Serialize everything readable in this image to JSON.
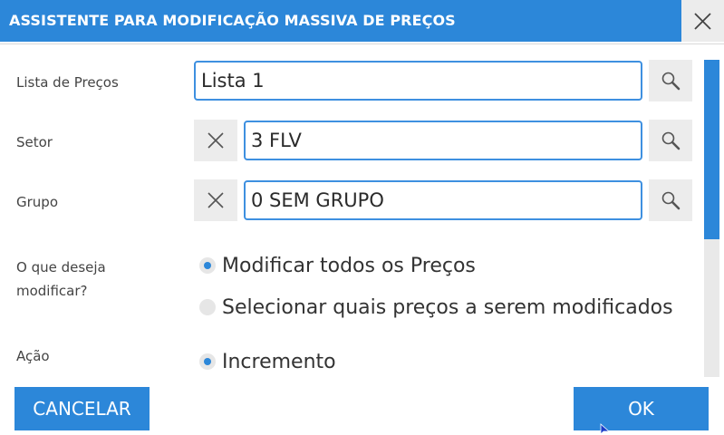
{
  "window": {
    "title": "ASSISTENTE PARA MODIFICAÇÃO MASSIVA DE PREÇOS",
    "close_icon": "close-icon"
  },
  "form": {
    "price_list": {
      "label": "Lista de Preços",
      "value": "Lista 1"
    },
    "sector": {
      "label": "Setor",
      "value": "3 FLV"
    },
    "group": {
      "label": "Grupo",
      "value": "0 SEM GRUPO"
    },
    "modify": {
      "label": "O que deseja modificar?",
      "options": [
        {
          "label": "Modificar todos os Preços",
          "selected": true
        },
        {
          "label": "Selecionar quais preços a serem modificados",
          "selected": false
        }
      ]
    },
    "action": {
      "label": "Ação",
      "options": [
        {
          "label": "Incremento",
          "selected": true
        }
      ]
    }
  },
  "buttons": {
    "cancel": "CANCELAR",
    "ok": "OK"
  },
  "colors": {
    "accent": "#2c87d9",
    "field_border": "#3e90e0",
    "button_gray": "#ececec"
  }
}
